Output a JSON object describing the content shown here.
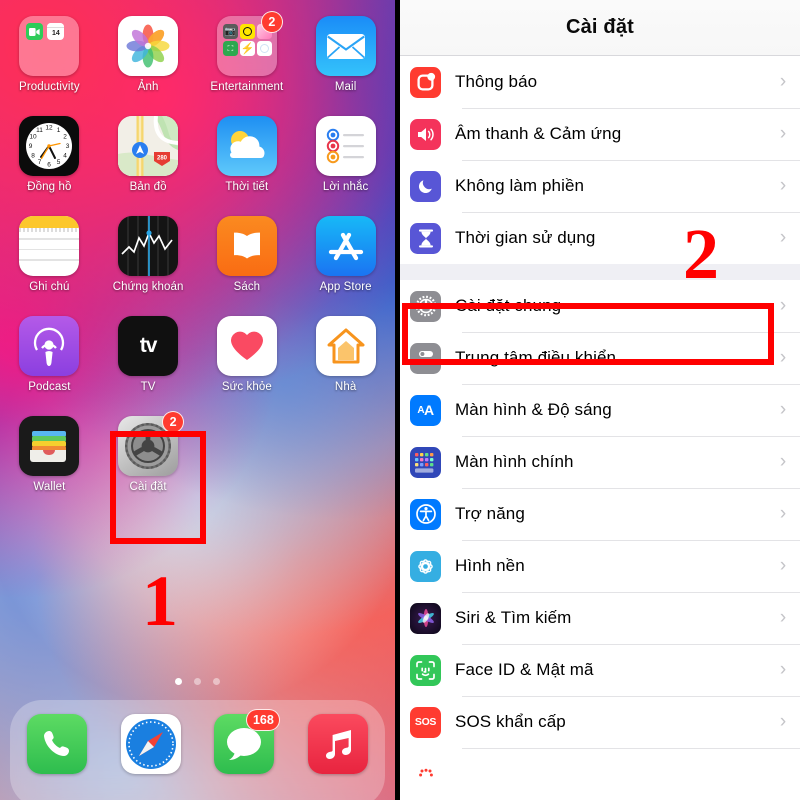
{
  "home": {
    "rows": [
      [
        {
          "label": "Productivity",
          "icon": "productivity-folder-icon",
          "badge": null
        },
        {
          "label": "Ảnh",
          "icon": "photos-icon",
          "badge": null
        },
        {
          "label": "Entertainment",
          "icon": "entertainment-folder-icon",
          "badge": "2"
        },
        {
          "label": "Mail",
          "icon": "mail-icon",
          "badge": null
        }
      ],
      [
        {
          "label": "Đồng hồ",
          "icon": "clock-icon",
          "badge": null
        },
        {
          "label": "Bản đồ",
          "icon": "maps-icon",
          "badge": null
        },
        {
          "label": "Thời tiết",
          "icon": "weather-icon",
          "badge": null
        },
        {
          "label": "Lời nhắc",
          "icon": "reminders-icon",
          "badge": null
        }
      ],
      [
        {
          "label": "Ghi chú",
          "icon": "notes-icon",
          "badge": null
        },
        {
          "label": "Chứng khoán",
          "icon": "stocks-icon",
          "badge": null
        },
        {
          "label": "Sách",
          "icon": "books-icon",
          "badge": null
        },
        {
          "label": "App Store",
          "icon": "app-store-icon",
          "badge": null
        }
      ],
      [
        {
          "label": "Podcast",
          "icon": "podcasts-icon",
          "badge": null
        },
        {
          "label": "TV",
          "icon": "tv-icon",
          "badge": null
        },
        {
          "label": "Sức khỏe",
          "icon": "health-icon",
          "badge": null
        },
        {
          "label": "Nhà",
          "icon": "home-app-icon",
          "badge": null
        }
      ],
      [
        {
          "label": "Wallet",
          "icon": "wallet-icon",
          "badge": null
        },
        {
          "label": "Cài đặt",
          "icon": "settings-gear-icon",
          "badge": "2"
        }
      ]
    ],
    "dock": [
      {
        "label": "",
        "icon": "phone-icon",
        "badge": null
      },
      {
        "label": "",
        "icon": "safari-icon",
        "badge": null
      },
      {
        "label": "",
        "icon": "messages-icon",
        "badge": "168"
      },
      {
        "label": "",
        "icon": "music-icon",
        "badge": null
      }
    ],
    "page_dots": {
      "count": 3,
      "active_index": 0
    }
  },
  "annotations": {
    "step_one": "1",
    "step_two": "2",
    "highlight_color": "#ff0000"
  },
  "settings": {
    "title": "Cài đặt",
    "chevron": "›",
    "group_one": [
      {
        "label": "Thông báo",
        "icon": "notifications-icon",
        "color": "#ff3b30"
      },
      {
        "label": "Âm thanh & Cảm ứng",
        "icon": "sounds-haptics-icon",
        "color": "#f4335b"
      },
      {
        "label": "Không làm phiền",
        "icon": "do-not-disturb-icon",
        "color": "#5856d6"
      },
      {
        "label": "Thời gian sử dụng",
        "icon": "screen-time-icon",
        "color": "#5856d6"
      }
    ],
    "group_two": [
      {
        "label": "Cài đặt chung",
        "icon": "general-gear-icon",
        "color": "#8e8e93",
        "highlighted": true
      },
      {
        "label": "Trung tâm điều khiển",
        "icon": "control-center-icon",
        "color": "#8e8e93"
      },
      {
        "label": "Màn hình & Độ sáng",
        "icon": "display-brightness-icon",
        "color": "#007aff"
      },
      {
        "label": "Màn hình chính",
        "icon": "home-screen-icon",
        "color": "#3047b8"
      },
      {
        "label": "Trợ năng",
        "icon": "accessibility-icon",
        "color": "#007aff"
      },
      {
        "label": "Hình nền",
        "icon": "wallpaper-icon",
        "color": "#35aee2"
      },
      {
        "label": "Siri & Tìm kiếm",
        "icon": "siri-icon",
        "color": "#1a1030"
      },
      {
        "label": "Face ID & Mật mã",
        "icon": "face-id-icon",
        "color": "#32c759"
      },
      {
        "label": "SOS khẩn cấp",
        "icon": "emergency-sos-icon",
        "color": "#ff3b30"
      },
      {
        "label": "",
        "icon": "battery-icon",
        "color": "#ffffff"
      }
    ]
  }
}
